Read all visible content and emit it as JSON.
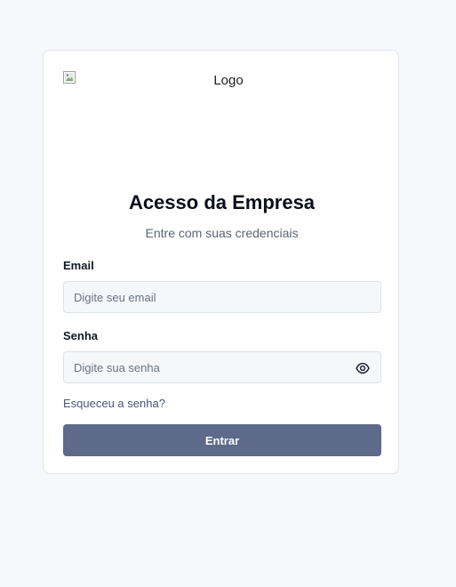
{
  "logo": {
    "alt_text": "Logo",
    "icon": "broken-image-icon"
  },
  "header": {
    "title": "Acesso da Empresa",
    "subtitle": "Entre com suas credenciais"
  },
  "form": {
    "email": {
      "label": "Email",
      "value": "",
      "placeholder": "Digite seu email"
    },
    "password": {
      "label": "Senha",
      "value": "",
      "placeholder": "Digite sua senha",
      "toggle_icon": "eye-icon"
    },
    "forgot_link": "Esqueceu a senha?",
    "submit_label": "Entrar"
  },
  "colors": {
    "page_background": "#f7f8fb",
    "card_background": "#ffffff",
    "primary_button": "#5e6a8a",
    "link": "#4b5675"
  }
}
